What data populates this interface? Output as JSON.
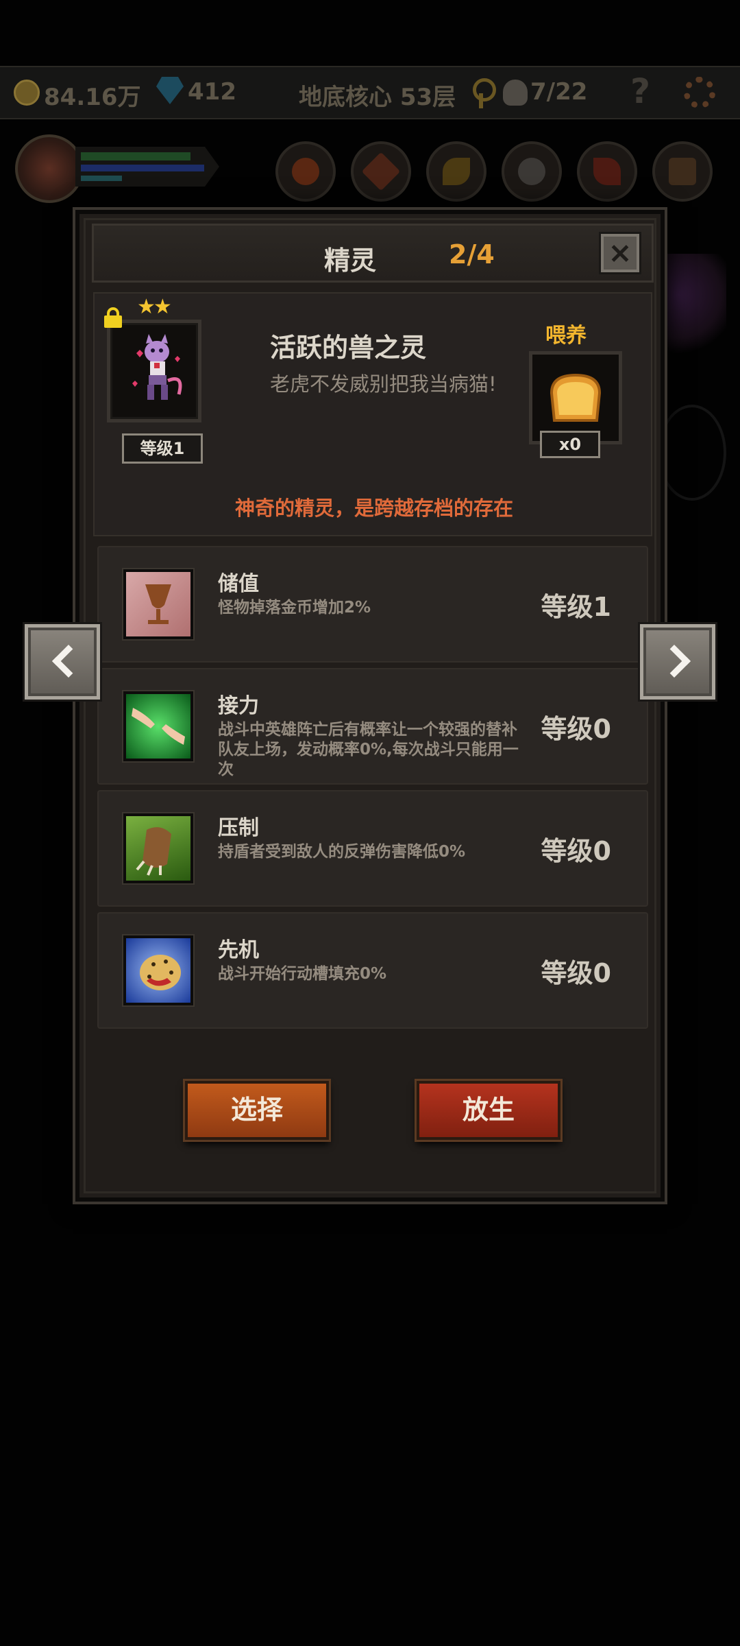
{
  "hud": {
    "gold": "84.16万",
    "gems": "412",
    "location": "地底核心 53层",
    "kills": "7/22",
    "help_symbol": "?"
  },
  "dialog": {
    "title": "精灵",
    "counter": "2/4",
    "pet": {
      "stars": "★★",
      "level": "等级1",
      "name": "活跃的兽之灵",
      "description": "老虎不发威别把我当病猫!"
    },
    "feed": {
      "label": "喂养",
      "count": "x0"
    },
    "special_note": "神奇的精灵，是跨越存档的存在",
    "skills": [
      {
        "name": "储值",
        "desc": "怪物掉落金币增加2%",
        "level": "等级1",
        "icon": "goblet-icon"
      },
      {
        "name": "接力",
        "desc": "战斗中英雄阵亡后有概率让一个较强的替补队友上场，发动概率0%,每次战斗只能用一次",
        "level": "等级0",
        "icon": "hands-icon"
      },
      {
        "name": "压制",
        "desc": "持盾者受到敌人的反弹伤害降低0%",
        "level": "等级0",
        "icon": "claw-icon"
      },
      {
        "name": "先机",
        "desc": "战斗开始行动槽填充0%",
        "level": "等级0",
        "icon": "leopard-icon"
      }
    ],
    "buttons": {
      "select": "选择",
      "release": "放生"
    }
  },
  "colors": {
    "accent_orange": "#e6a036",
    "special_text": "#e06a3a",
    "feed_label": "#f2b52e",
    "select_button": "#c25a1c",
    "release_button": "#b5331e"
  }
}
